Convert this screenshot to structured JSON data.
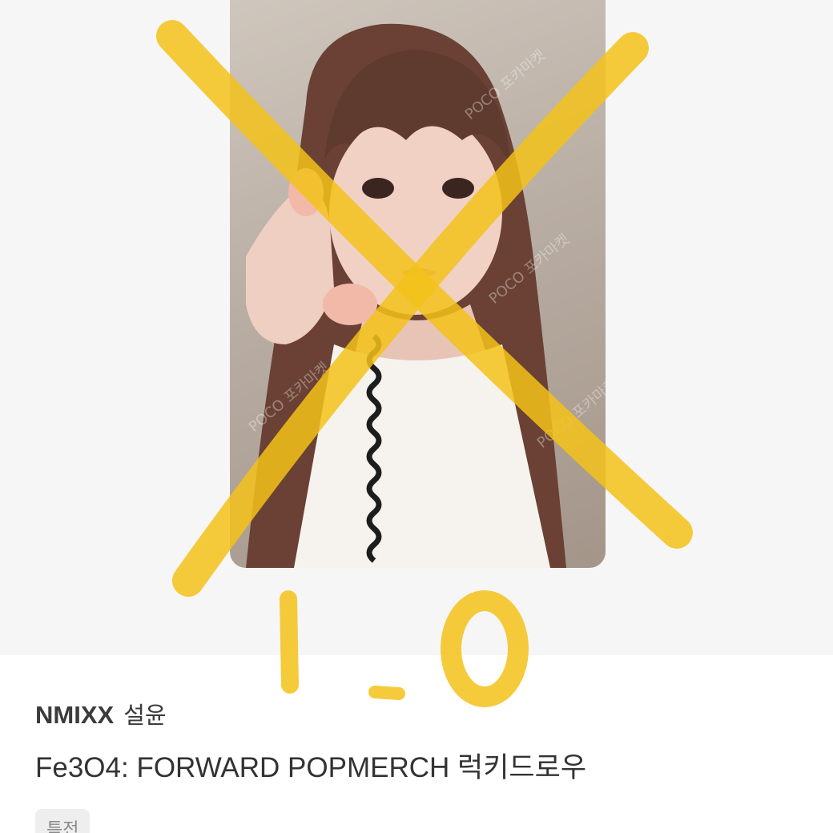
{
  "product": {
    "artist": "NMIXX",
    "member": "설윤",
    "album_title": "Fe3O4: FORWARD POPMERCH 럭키드로우",
    "badge_label": "특전"
  },
  "image": {
    "watermark_text": "POCO 포카마켓",
    "handwritten_mark": "1.0"
  },
  "colors": {
    "hero_background": "#f6f6f6",
    "marker_yellow": "#f3c21a",
    "text_primary": "#3b3b3b",
    "badge_background": "#eeeeee"
  }
}
